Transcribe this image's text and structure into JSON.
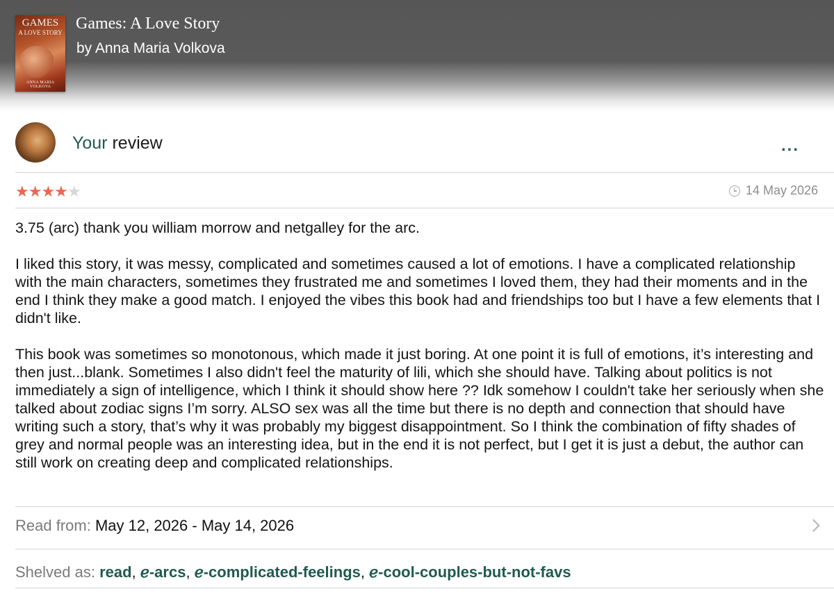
{
  "book": {
    "title": "Games: A Love Story",
    "author": "by Anna Maria Volkova",
    "cover": {
      "title": "GAMES",
      "subtitle": "A LOVE STORY",
      "author": "ANNA MARIA VOLKOVA"
    }
  },
  "review_header": {
    "your": "Your",
    "rest": " review",
    "more_label": "..."
  },
  "rating": {
    "stars_filled": 4,
    "stars_total": 5,
    "filled_glyph": "★★★★",
    "empty_glyph": "★"
  },
  "date": "14 May 2026",
  "paragraphs": [
    "3.75 (arc) thank you william morrow and netgalley for the arc.",
    "I liked this story, it was messy, complicated and sometimes caused a lot of emotions. I have a complicated relationship with the main characters, sometimes they frustrated me and sometimes I loved them, they had their moments and in the end I think they make a good match. I enjoyed the vibes this book had and friendships too but I have a few elements that I didn't like.",
    "This book was sometimes so monotonous, which made it just boring. At one point it is full of emotions, it’s interesting and then just...blank. Sometimes I also didn't feel the maturity of lili, which she should have. Talking about politics is not immediately a sign of intelligence, which I think it should show here ?? Idk somehow I couldn't take her seriously when she talked about zodiac signs I’m sorry. ALSO sex was all the time but there is no depth and connection that should have writing such a story, that’s why it was probably my biggest disappointment. So I think the combination of fifty shades of grey and normal people was an interesting idea, but in the end it is not perfect, but I get it is just a debut, the author can still work on creating deep and complicated relationships."
  ],
  "read_from": {
    "label": "Read from:",
    "value": "May 12, 2026 - May 14, 2026"
  },
  "shelved": {
    "label": "Shelved as:",
    "shelves": [
      "read",
      "ℯ-arcs",
      "ℯ-complicated-feelings",
      "ℯ-cool-couples-but-not-favs"
    ],
    "separator": ","
  },
  "colors": {
    "accent": "#1f5a4f",
    "star": "#e46a50",
    "header_bg": "#565656"
  }
}
